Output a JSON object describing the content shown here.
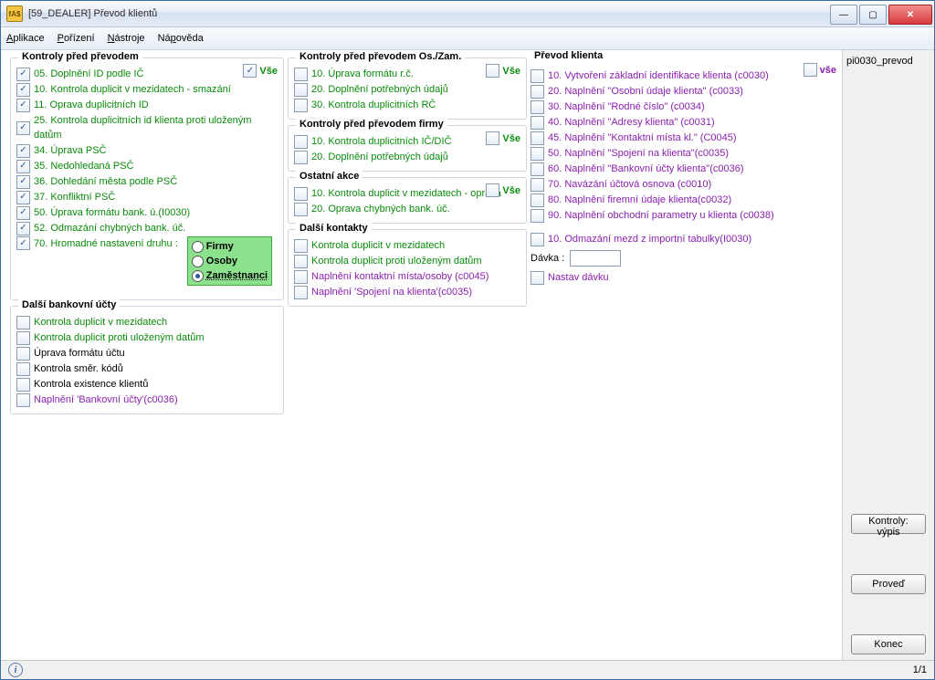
{
  "window": {
    "title": "[59_DEALER] Převod klientů"
  },
  "menu": {
    "app": "Aplikace",
    "por": "Pořízení",
    "nas": "Nástroje",
    "nap": "Nápověda"
  },
  "right": {
    "label": "pi0030_prevod",
    "btn_kontroly": "Kontroly: výpis",
    "btn_proved": "Proveď",
    "btn_konec": "Konec"
  },
  "status": {
    "page": "1/1"
  },
  "g1": {
    "title": "Kontroly před převodem",
    "vse": "Vše",
    "i": [
      "05. Doplnění ID podle IČ",
      "10. Kontrola duplicit v mezidatech - smazání",
      "11. Oprava duplicitních ID",
      "25. Kontrola duplicitních id klienta proti uloženým datům",
      "34. Úprava PSČ",
      "35. Nedohledaná PSČ",
      "36. Dohledání města podle PSČ",
      "37. Konfliktní PSČ",
      "50. Úprava formátu bank. ú.(I0030)",
      "52. Odmazání chybných bank. úč.",
      "70. Hromadné nastavení druhu :"
    ],
    "radios": {
      "firmy": "Firmy",
      "osoby": "Osoby",
      "zam": "Zaměstnanci"
    }
  },
  "g2": {
    "title": "Další bankovní účty",
    "i": [
      {
        "t": "Kontrola duplicit v mezidatech",
        "c": "green"
      },
      {
        "t": "Kontrola duplicit proti uloženým datům",
        "c": "green"
      },
      {
        "t": "Úprava formátu účtu",
        "c": ""
      },
      {
        "t": "Kontrola směr. kódů",
        "c": ""
      },
      {
        "t": "Kontrola existence klientů",
        "c": ""
      },
      {
        "t": "Naplnění 'Bankovní účty'(c0036)",
        "c": "purple"
      }
    ]
  },
  "g3": {
    "title": "Kontroly před převodem Os./Zam.",
    "vse": "Vše",
    "i": [
      "10. Úprava formátu r.č.",
      "20. Doplnění potřebných údajů",
      "30. Kontrola duplicitních RČ"
    ]
  },
  "g4": {
    "title": "Kontroly před převodem firmy",
    "vse": "Vše",
    "i": [
      "10. Kontrola duplicitních IČ/DIČ",
      "20. Doplnění potřebných údajů"
    ]
  },
  "g5": {
    "title": "Ostatní akce",
    "vse": "Vše",
    "i": [
      "10. Kontrola duplicit v mezidatech - oprava",
      "20. Oprava chybných bank. úč."
    ]
  },
  "g6": {
    "title": "Další kontakty",
    "i": [
      {
        "t": "Kontrola duplicit v mezidatech",
        "c": "green"
      },
      {
        "t": "Kontrola duplicit proti uloženým datům",
        "c": "green"
      },
      {
        "t": "Naplnění kontaktní místa/osoby (c0045)",
        "c": "purple"
      },
      {
        "t": "Naplnění 'Spojení na klienta'(c0035)",
        "c": "purple"
      }
    ]
  },
  "g7": {
    "title": "Převod klienta",
    "vse": "vše",
    "i": [
      "10. Vytvoření základní identifikace klienta (c0030)",
      "20. Naplnění \"Osobní údaje klienta\" (c0033)",
      "30. Naplnění \"Rodné číslo\" (c0034)",
      "40. Naplnění \"Adresy klienta\" (c0031)",
      "45. Naplnění \"Kontaktní místa kl.\" (C0045)",
      "50. Naplnění \"Spojení na klienta\"(c0035)",
      "60. Naplnění \"Bankovní účty klienta\"(c0036)",
      "70. Navázání účtová osnova (c0010)",
      "80. Naplnění  firemní údaje klienta(c0032)",
      "90. Naplnění obchodní parametry u klienta (c0038)"
    ],
    "extra": "10. Odmazání mezd z importní tabulky(I0030)",
    "davka": "Dávka :",
    "nastav": "Nastav dávku"
  }
}
